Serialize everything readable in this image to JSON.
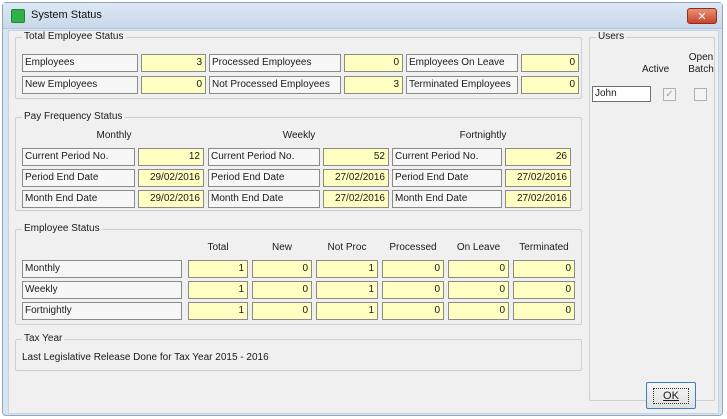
{
  "window": {
    "title": "System Status",
    "close_glyph": "✕"
  },
  "total_status": {
    "legend": "Total Employee Status",
    "employees_label": "Employees",
    "employees_value": "3",
    "new_label": "New Employees",
    "new_value": "0",
    "processed_label": "Processed Employees",
    "processed_value": "0",
    "not_processed_label": "Not Processed Employees",
    "not_processed_value": "3",
    "on_leave_label": "Employees On Leave",
    "on_leave_value": "0",
    "terminated_label": "Terminated Employees",
    "terminated_value": "0"
  },
  "pay_frequency": {
    "legend": "Pay Frequency Status",
    "monthly": {
      "header": "Monthly",
      "period_no_label": "Current Period No.",
      "period_no": "12",
      "period_end_label": "Period End Date",
      "period_end": "29/02/2016",
      "month_end_label": "Month End Date",
      "month_end": "29/02/2016"
    },
    "weekly": {
      "header": "Weekly",
      "period_no_label": "Current Period No.",
      "period_no": "52",
      "period_end_label": "Period End Date",
      "period_end": "27/02/2016",
      "month_end_label": "Month End Date",
      "month_end": "27/02/2016"
    },
    "fortnightly": {
      "header": "Fortnightly",
      "period_no_label": "Current Period No.",
      "period_no": "26",
      "period_end_label": "Period End Date",
      "period_end": "27/02/2016",
      "month_end_label": "Month End Date",
      "month_end": "27/02/2016"
    }
  },
  "employee_status": {
    "legend": "Employee Status",
    "columns": [
      "Total",
      "New",
      "Not Proc",
      "Processed",
      "On Leave",
      "Terminated"
    ],
    "rows": [
      {
        "label": "Monthly",
        "values": [
          "1",
          "0",
          "1",
          "0",
          "0",
          "0"
        ]
      },
      {
        "label": "Weekly",
        "values": [
          "1",
          "0",
          "1",
          "0",
          "0",
          "0"
        ]
      },
      {
        "label": "Fortnightly",
        "values": [
          "1",
          "0",
          "1",
          "0",
          "0",
          "0"
        ]
      }
    ]
  },
  "tax_year": {
    "legend": "Tax Year",
    "text": "Last Legislative Release Done for Tax Year  2015 - 2016"
  },
  "users": {
    "legend": "Users",
    "active_header": "Active",
    "open_batch_header_line1": "Open",
    "open_batch_header_line2": "Batch",
    "list": [
      {
        "name": "John",
        "active": true,
        "open_batch": false
      }
    ],
    "check_glyph": "✓"
  },
  "ok_button": {
    "label": "OK"
  },
  "colors": {
    "value_fill": "#ffffc2",
    "window_frame": "#d9e4f1",
    "close_button": "#c8452b"
  }
}
